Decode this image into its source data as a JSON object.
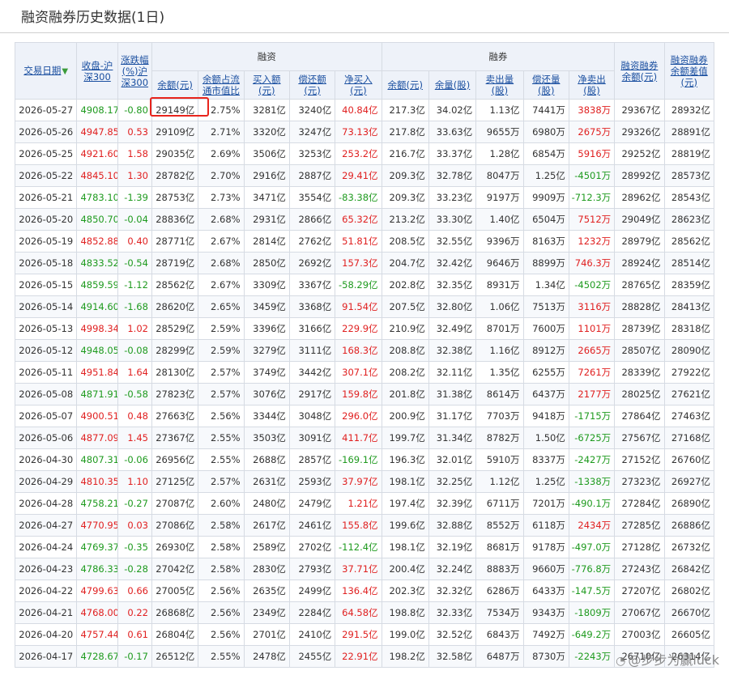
{
  "page": {
    "title": "融资融券历史数据(1日)"
  },
  "table": {
    "headers": {
      "date": "交易日期",
      "close": "收盘-沪深300",
      "change": "涨跌幅(%)沪深300",
      "margin_group": "融资",
      "short_group": "融券",
      "m_balance": "余额(元)",
      "m_ratio": "余额占流通市值比",
      "m_buy": "买入额(元)",
      "m_repay": "偿还额(元)",
      "m_net": "净买入(元)",
      "s_balance": "余额(元)",
      "s_volume": "余量(股)",
      "s_sell": "卖出量(股)",
      "s_repay": "偿还量(股)",
      "s_net": "净卖出(股)",
      "total_balance": "融资融券余额(元)",
      "diff": "融资融券余额差值(元)"
    },
    "rows": [
      [
        "2026-05-27",
        "4908.17",
        "-0.80",
        "29149亿",
        "2.75%",
        "3281亿",
        "3240亿",
        "40.84亿",
        "217.3亿",
        "34.02亿",
        "1.13亿",
        "7441万",
        "3838万",
        "29367亿",
        "28932亿"
      ],
      [
        "2026-05-26",
        "4947.85",
        "0.53",
        "29109亿",
        "2.71%",
        "3320亿",
        "3247亿",
        "73.13亿",
        "217.8亿",
        "33.63亿",
        "9655万",
        "6980万",
        "2675万",
        "29326亿",
        "28891亿"
      ],
      [
        "2026-05-25",
        "4921.60",
        "1.58",
        "29035亿",
        "2.69%",
        "3506亿",
        "3253亿",
        "253.2亿",
        "216.7亿",
        "33.37亿",
        "1.28亿",
        "6854万",
        "5916万",
        "29252亿",
        "28819亿"
      ],
      [
        "2026-05-22",
        "4845.10",
        "1.30",
        "28782亿",
        "2.70%",
        "2916亿",
        "2887亿",
        "29.41亿",
        "209.3亿",
        "32.78亿",
        "8047万",
        "1.25亿",
        "-4501万",
        "28992亿",
        "28573亿"
      ],
      [
        "2026-05-21",
        "4783.10",
        "-1.39",
        "28753亿",
        "2.73%",
        "3471亿",
        "3554亿",
        "-83.38亿",
        "209.3亿",
        "33.23亿",
        "9197万",
        "9909万",
        "-712.3万",
        "28962亿",
        "28543亿"
      ],
      [
        "2026-05-20",
        "4850.70",
        "-0.04",
        "28836亿",
        "2.68%",
        "2931亿",
        "2866亿",
        "65.32亿",
        "213.2亿",
        "33.30亿",
        "1.40亿",
        "6504万",
        "7512万",
        "29049亿",
        "28623亿"
      ],
      [
        "2026-05-19",
        "4852.88",
        "0.40",
        "28771亿",
        "2.67%",
        "2814亿",
        "2762亿",
        "51.81亿",
        "208.5亿",
        "32.55亿",
        "9396万",
        "8163万",
        "1232万",
        "28979亿",
        "28562亿"
      ],
      [
        "2026-05-18",
        "4833.52",
        "-0.54",
        "28719亿",
        "2.68%",
        "2850亿",
        "2692亿",
        "157.3亿",
        "204.7亿",
        "32.42亿",
        "9646万",
        "8899万",
        "746.3万",
        "28924亿",
        "28514亿"
      ],
      [
        "2026-05-15",
        "4859.59",
        "-1.12",
        "28562亿",
        "2.67%",
        "3309亿",
        "3367亿",
        "-58.29亿",
        "202.8亿",
        "32.35亿",
        "8931万",
        "1.34亿",
        "-4502万",
        "28765亿",
        "28359亿"
      ],
      [
        "2026-05-14",
        "4914.60",
        "-1.68",
        "28620亿",
        "2.65%",
        "3459亿",
        "3368亿",
        "91.54亿",
        "207.5亿",
        "32.80亿",
        "1.06亿",
        "7513万",
        "3116万",
        "28828亿",
        "28413亿"
      ],
      [
        "2026-05-13",
        "4998.34",
        "1.02",
        "28529亿",
        "2.59%",
        "3396亿",
        "3166亿",
        "229.9亿",
        "210.9亿",
        "32.49亿",
        "8701万",
        "7600万",
        "1101万",
        "28739亿",
        "28318亿"
      ],
      [
        "2026-05-12",
        "4948.05",
        "-0.08",
        "28299亿",
        "2.59%",
        "3279亿",
        "3111亿",
        "168.3亿",
        "208.8亿",
        "32.38亿",
        "1.16亿",
        "8912万",
        "2665万",
        "28507亿",
        "28090亿"
      ],
      [
        "2026-05-11",
        "4951.84",
        "1.64",
        "28130亿",
        "2.57%",
        "3749亿",
        "3442亿",
        "307.1亿",
        "208.2亿",
        "32.11亿",
        "1.35亿",
        "6255万",
        "7261万",
        "28339亿",
        "27922亿"
      ],
      [
        "2026-05-08",
        "4871.91",
        "-0.58",
        "27823亿",
        "2.57%",
        "3076亿",
        "2917亿",
        "159.8亿",
        "201.8亿",
        "31.38亿",
        "8614万",
        "6437万",
        "2177万",
        "28025亿",
        "27621亿"
      ],
      [
        "2026-05-07",
        "4900.51",
        "0.48",
        "27663亿",
        "2.56%",
        "3344亿",
        "3048亿",
        "296.0亿",
        "200.9亿",
        "31.17亿",
        "7703万",
        "9418万",
        "-1715万",
        "27864亿",
        "27463亿"
      ],
      [
        "2026-05-06",
        "4877.09",
        "1.45",
        "27367亿",
        "2.55%",
        "3503亿",
        "3091亿",
        "411.7亿",
        "199.7亿",
        "31.34亿",
        "8782万",
        "1.50亿",
        "-6725万",
        "27567亿",
        "27168亿"
      ],
      [
        "2026-04-30",
        "4807.31",
        "-0.06",
        "26956亿",
        "2.55%",
        "2688亿",
        "2857亿",
        "-169.1亿",
        "196.3亿",
        "32.01亿",
        "5910万",
        "8337万",
        "-2427万",
        "27152亿",
        "26760亿"
      ],
      [
        "2026-04-29",
        "4810.35",
        "1.10",
        "27125亿",
        "2.57%",
        "2631亿",
        "2593亿",
        "37.97亿",
        "198.1亿",
        "32.25亿",
        "1.12亿",
        "1.25亿",
        "-1338万",
        "27323亿",
        "26927亿"
      ],
      [
        "2026-04-28",
        "4758.21",
        "-0.27",
        "27087亿",
        "2.60%",
        "2480亿",
        "2479亿",
        "1.21亿",
        "197.4亿",
        "32.39亿",
        "6711万",
        "7201万",
        "-490.1万",
        "27284亿",
        "26890亿"
      ],
      [
        "2026-04-27",
        "4770.95",
        "0.03",
        "27086亿",
        "2.58%",
        "2617亿",
        "2461亿",
        "155.8亿",
        "199.6亿",
        "32.88亿",
        "8552万",
        "6118万",
        "2434万",
        "27285亿",
        "26886亿"
      ],
      [
        "2026-04-24",
        "4769.37",
        "-0.35",
        "26930亿",
        "2.58%",
        "2589亿",
        "2702亿",
        "-112.4亿",
        "198.1亿",
        "32.19亿",
        "8681万",
        "9178万",
        "-497.0万",
        "27128亿",
        "26732亿"
      ],
      [
        "2026-04-23",
        "4786.33",
        "-0.28",
        "27042亿",
        "2.58%",
        "2830亿",
        "2793亿",
        "37.71亿",
        "200.4亿",
        "32.24亿",
        "8883万",
        "9660万",
        "-776.8万",
        "27243亿",
        "26842亿"
      ],
      [
        "2026-04-22",
        "4799.63",
        "0.66",
        "27005亿",
        "2.56%",
        "2635亿",
        "2499亿",
        "136.4亿",
        "202.3亿",
        "32.32亿",
        "6286万",
        "6433万",
        "-147.5万",
        "27207亿",
        "26802亿"
      ],
      [
        "2026-04-21",
        "4768.00",
        "0.22",
        "26868亿",
        "2.56%",
        "2349亿",
        "2284亿",
        "64.58亿",
        "198.8亿",
        "32.33亿",
        "7534万",
        "9343万",
        "-1809万",
        "27067亿",
        "26670亿"
      ],
      [
        "2026-04-20",
        "4757.44",
        "0.61",
        "26804亿",
        "2.56%",
        "2701亿",
        "2410亿",
        "291.5亿",
        "199.0亿",
        "32.52亿",
        "6843万",
        "7492万",
        "-649.2万",
        "27003亿",
        "26605亿"
      ],
      [
        "2026-04-17",
        "4728.67",
        "-0.17",
        "26512亿",
        "2.55%",
        "2478亿",
        "2455亿",
        "22.91亿",
        "198.2亿",
        "32.58亿",
        "6487万",
        "8730万",
        "-2243万",
        "26710亿",
        "26314亿"
      ]
    ]
  },
  "watermark": {
    "text": "@步步为赢luck"
  },
  "colors": {
    "up": "#e02020",
    "down": "#1e9a1e",
    "link": "#1a4fa0",
    "highlight": "#e8241c"
  }
}
